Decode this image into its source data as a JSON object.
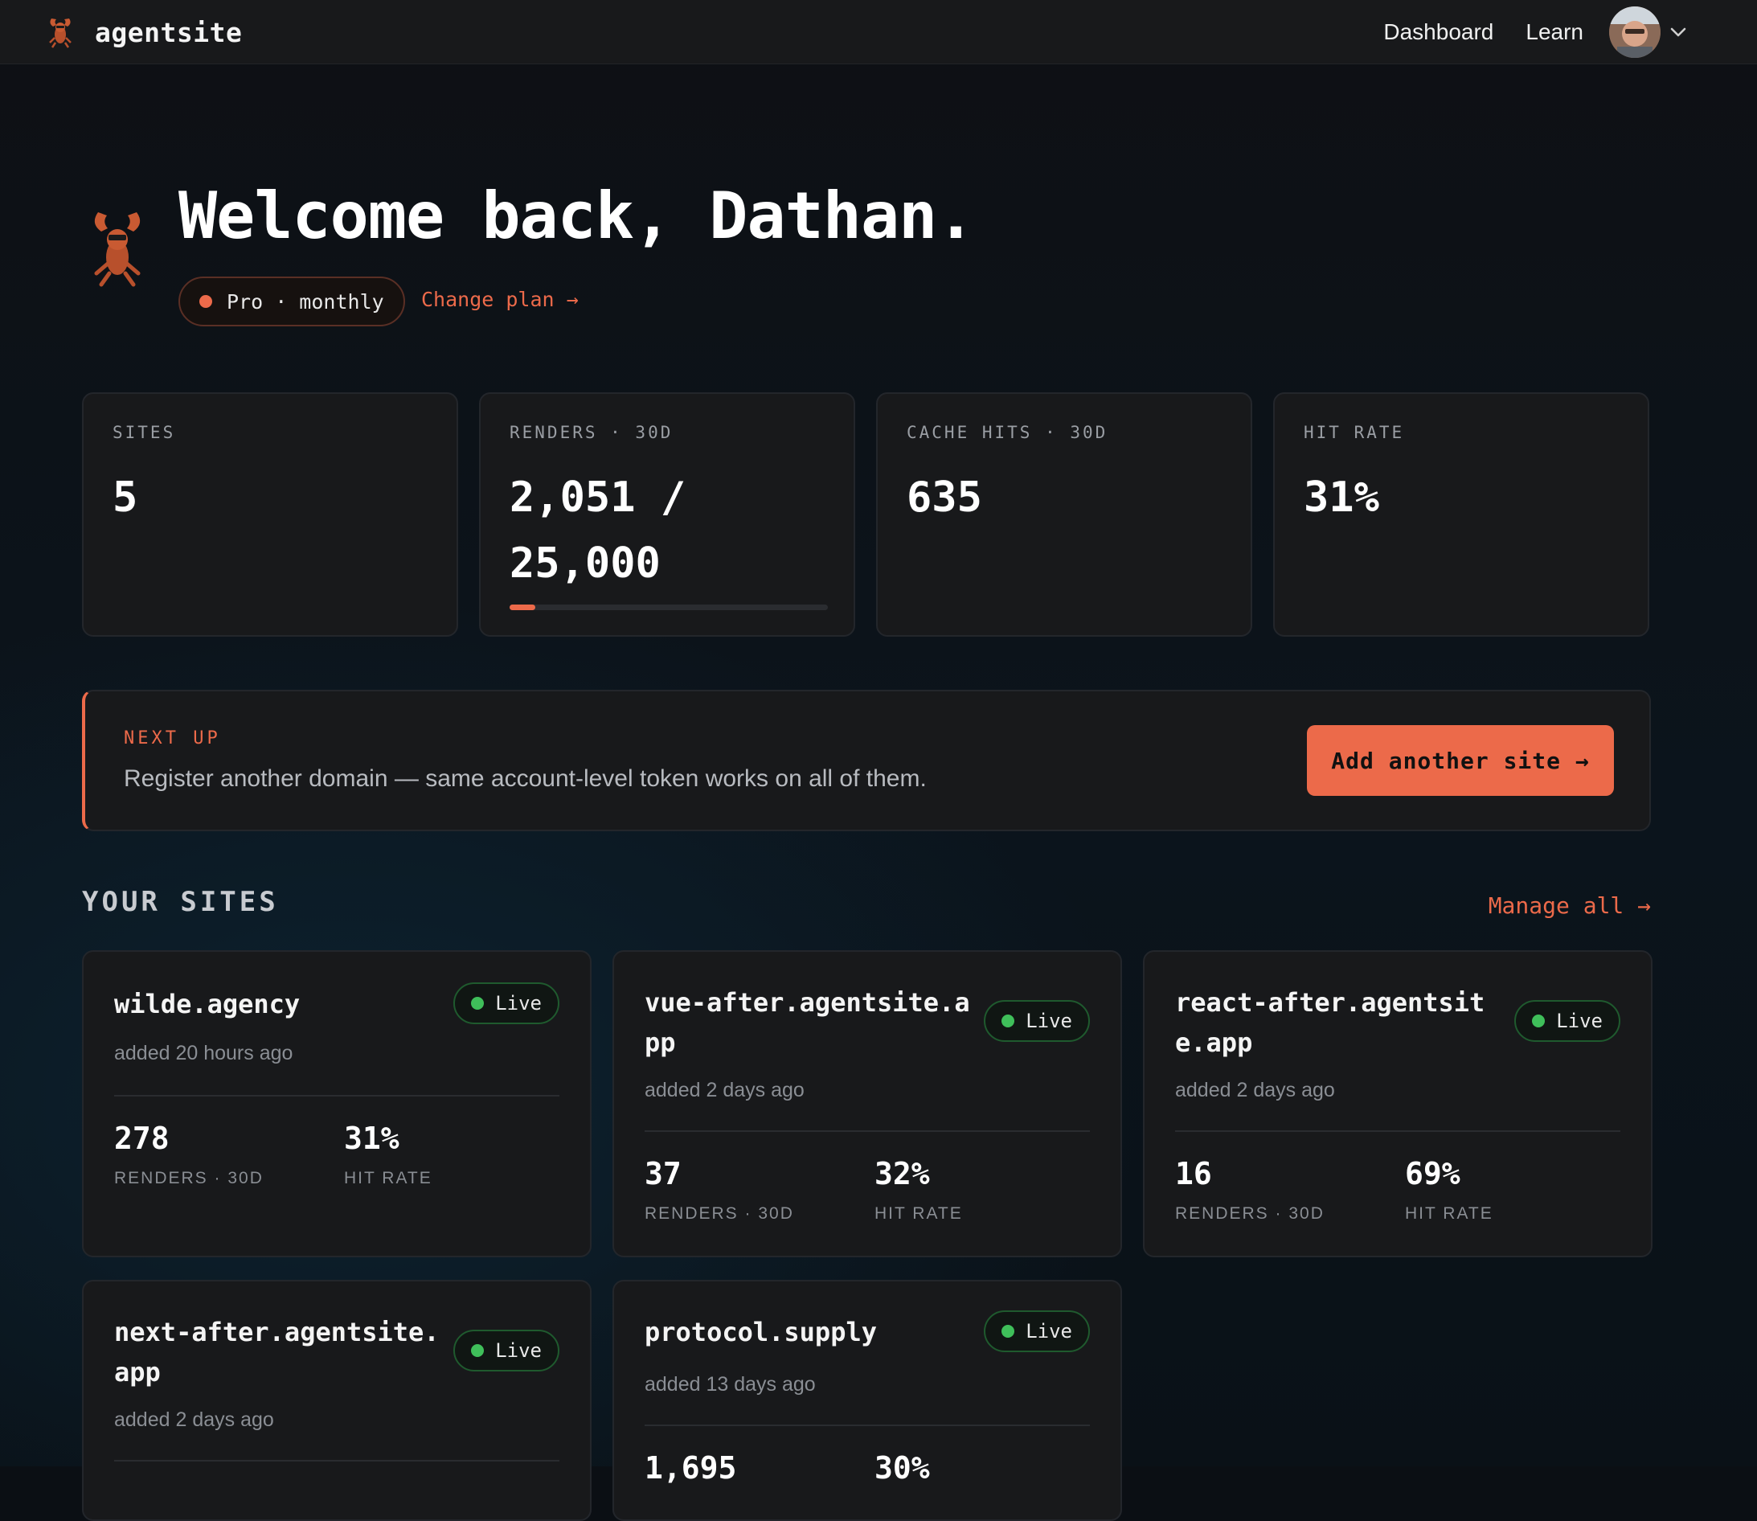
{
  "nav": {
    "brand": "agentsite",
    "links": [
      "Dashboard",
      "Learn"
    ]
  },
  "hero": {
    "title": "Welcome back, Dathan.",
    "plan": "Pro · monthly",
    "change_plan": "Change plan →"
  },
  "stats": [
    {
      "label": "SITES",
      "value": "5"
    },
    {
      "label": "RENDERS · 30D",
      "value": "2,051 / 25,000",
      "progress": 0.082
    },
    {
      "label": "CACHE HITS · 30D",
      "value": "635"
    },
    {
      "label": "HIT RATE",
      "value": "31%"
    }
  ],
  "next_up": {
    "label": "NEXT UP",
    "text": "Register another domain — same account-level token works on all of them.",
    "button": "Add another site →"
  },
  "sites_section": {
    "title": "YOUR SITES",
    "manage_all": "Manage all →"
  },
  "sites": [
    {
      "name": "wilde.agency",
      "status": "Live",
      "added": "added 20 hours ago",
      "renders": "278",
      "renders_label": "RENDERS · 30D",
      "hit_rate": "31%",
      "hit_rate_label": "HIT RATE"
    },
    {
      "name": "vue-after.agentsite.app",
      "status": "Live",
      "added": "added 2 days ago",
      "renders": "37",
      "renders_label": "RENDERS · 30D",
      "hit_rate": "32%",
      "hit_rate_label": "HIT RATE"
    },
    {
      "name": "react-after.agentsite.app",
      "status": "Live",
      "added": "added 2 days ago",
      "renders": "16",
      "renders_label": "RENDERS · 30D",
      "hit_rate": "69%",
      "hit_rate_label": "HIT RATE"
    },
    {
      "name": "next-after.agentsite.app",
      "status": "Live",
      "added": "added 2 days ago"
    },
    {
      "name": "protocol.supply",
      "status": "Live",
      "added": "added 13 days ago",
      "renders": "1,695",
      "hit_rate": "30%"
    }
  ],
  "colors": {
    "accent": "#ec6a4a",
    "live": "#3fbf5a",
    "card": "#18191b"
  }
}
